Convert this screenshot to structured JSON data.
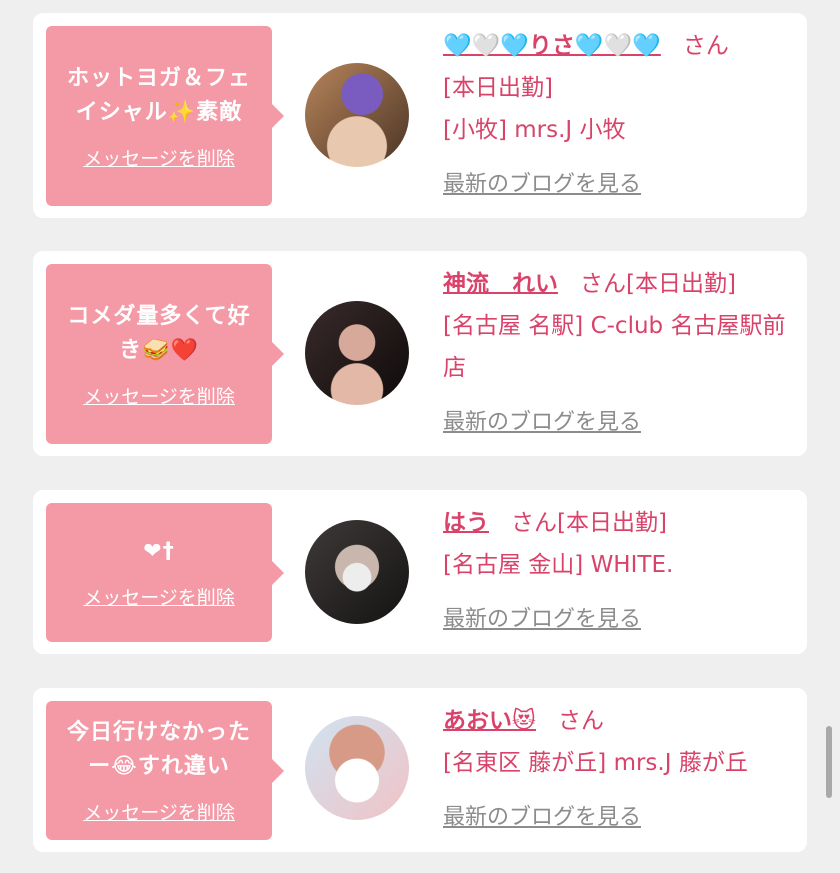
{
  "delete_label": "メッセージを削除",
  "blog_label": "最新のブログを見る",
  "san_label": "さん",
  "items": [
    {
      "message": "ホットヨガ＆フェイシャル✨素敵",
      "name": "🩵🤍🩵りさ🩵🤍🩵",
      "line1": "[本日出勤]",
      "line2": "[小牧] mrs.J 小牧"
    },
    {
      "message": "コメダ量多くて好き🥪❤️",
      "name": "神流　れい",
      "line1": "さん[本日出勤]",
      "line2": "[名古屋 名駅] C-club 名古屋駅前店"
    },
    {
      "message": "❤︎†",
      "name": "はう",
      "line1": "さん[本日出勤]",
      "line2": "[名古屋 金山] WHITE."
    },
    {
      "message": "今日行けなかったー😂すれ違い",
      "name": "あおい😻",
      "line1": "さん",
      "line2": "[名東区 藤が丘] mrs.J 藤が丘"
    }
  ]
}
